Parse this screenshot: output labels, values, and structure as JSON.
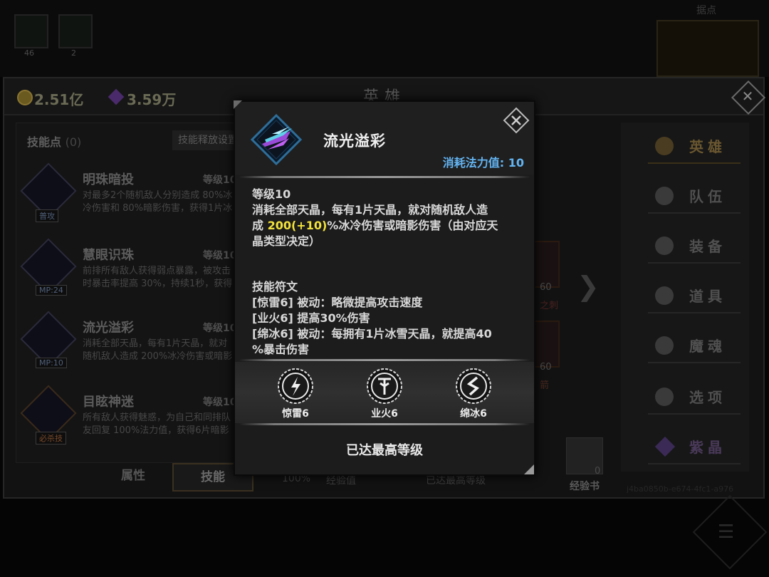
{
  "background": {
    "top_slots": [
      {
        "count": "46"
      },
      {
        "count": "2"
      }
    ],
    "map_label": "据点",
    "currency": {
      "gold": "2.51亿",
      "gem": "3.59万"
    },
    "panel_title": "英雄",
    "skill_points_label": "技能点",
    "skill_points_value": "(0)",
    "release_setting": "技能释放设置",
    "skills": [
      {
        "name": "明珠暗投",
        "level": "等级10",
        "tag": "普攻",
        "desc_line1": "对最多2个随机敌人分别造成 80%冰",
        "desc_line2": "冷伤害和 80%暗影伤害，获得1片冰"
      },
      {
        "name": "慧眼识珠",
        "level": "等级10",
        "tag": "MP:24",
        "desc_line1": "前排所有敌人获得弱点暴露，被攻击",
        "desc_line2": "时暴击率提高 30%，持续1秒，获得"
      },
      {
        "name": "流光溢彩",
        "level": "等级10",
        "tag": "MP:10",
        "desc_line1": "消耗全部天晶，每有1片天晶，就对",
        "desc_line2": "随机敌人造成 200%冰冷伤害或暗影"
      },
      {
        "name": "目眩神迷",
        "level": "等级10",
        "tag": "必杀技",
        "desc_line1": "所有敌人获得魅惑，为自己和同排队",
        "desc_line2": "友回复 100%法力值，获得6片暗影"
      }
    ],
    "tabs": [
      "属性",
      "技能"
    ],
    "nav": [
      "英雄",
      "队伍",
      "装备",
      "道具",
      "魔魂",
      "选项",
      "紫晶"
    ],
    "equip": [
      {
        "num": "60",
        "caption": "之刺"
      },
      {
        "num": "60",
        "caption": "箭"
      }
    ],
    "exp_percent": "100%",
    "exp_label": "经验值",
    "exp_max": "已达最高等级",
    "book_label": "经验书",
    "book_count": "0",
    "hash": "j4ba0850b-e674-4fc1-a976"
  },
  "popup": {
    "name": "流光溢彩",
    "mana_label": "消耗法力值: 10",
    "level": "等级10",
    "desc_a": "消耗全部天晶，每有1片天晶，就对随机敌人造",
    "desc_b_pre": "成 ",
    "desc_b_hl": "200(+10)",
    "desc_b_post": "%冰冷伤害或暗影伤害（由对应天",
    "desc_c": "晶类型决定）",
    "runes_title": "技能符文",
    "rune_lines": [
      "[惊雷6] 被动：略微提高攻击速度",
      "[业火6] 提高30%伤害",
      "[绵冰6] 被动：每拥有1片冰雪天晶，就提高40",
      "%暴击伤害"
    ],
    "runes": [
      {
        "label": "惊雷6",
        "icon": "lightning-rune-icon"
      },
      {
        "label": "业火6",
        "icon": "fire-rune-icon"
      },
      {
        "label": "绵冰6",
        "icon": "ice-rune-icon"
      }
    ],
    "footer": "已达最高等级"
  },
  "colors": {
    "mana": "#63b4f2",
    "highlight": "#f2e23c",
    "popup_bg": "#1c1c1c"
  }
}
